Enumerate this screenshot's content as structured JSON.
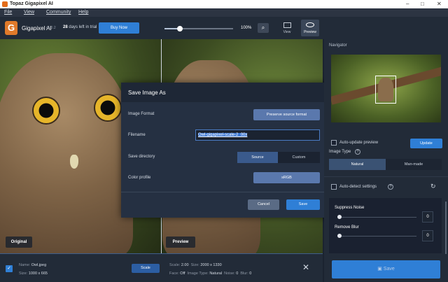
{
  "window": {
    "title": "Topaz Gigapixel AI"
  },
  "menu": [
    "File",
    "View",
    "Community",
    "Help"
  ],
  "toolbar": {
    "brand": "Gigapixel AI",
    "version": "v5.0.2",
    "trial_days": "28",
    "trial_text": "days left in trial",
    "buy_label": "Buy Now",
    "zoom_value": "100%",
    "zoom_slider_level": 0.22,
    "view_label": "View",
    "preview_label": "Preview"
  },
  "image": {
    "original_label": "Original",
    "preview_label": "Preview"
  },
  "dialog": {
    "title": "Save Image As",
    "image_format_label": "Image Format",
    "image_format_value": "Preserve source format",
    "filename_label": "Filename",
    "filename_value": "Owl-gigapixel-scale-2_00x",
    "save_directory_label": "Save directory",
    "dir_source": "Source",
    "dir_custom": "Custom",
    "color_profile_label": "Color profile",
    "color_profile_value": "sRGB",
    "cancel_label": "Cancel",
    "save_label": "Save"
  },
  "panel": {
    "navigator_label": "Navigator",
    "auto_update_label": "Auto-update preview",
    "update_label": "Update",
    "image_type_label": "Image Type",
    "natural_label": "Natural",
    "manmade_label": "Man-made",
    "auto_detect_label": "Auto-detect settings",
    "suppress_noise_label": "Suppress Noise",
    "suppress_noise_value": "0",
    "remove_blur_label": "Remove Blur",
    "remove_blur_value": "0",
    "save_label": "Save"
  },
  "bottom": {
    "name_label": "Name:",
    "name_value": "Owl.jpeg",
    "size_label": "Size:",
    "size_value": "1000 x 665",
    "scale_button": "Scale",
    "scale_label": "Scale:",
    "scale_value": "2.00",
    "out_size_label": "Size:",
    "out_size_value": "2000 x 1330",
    "face_label": "Face:",
    "face_value": "Off",
    "image_type_label": "Image Type:",
    "image_type_value": "Natural",
    "noise_label": "Noise:",
    "noise_value": "0",
    "blur_label": "Blur:",
    "blur_value": "0"
  },
  "colors": {
    "accent": "#2f7fd6",
    "background": "#1b2330",
    "panel": "#222b38",
    "dialog": "#253042"
  }
}
